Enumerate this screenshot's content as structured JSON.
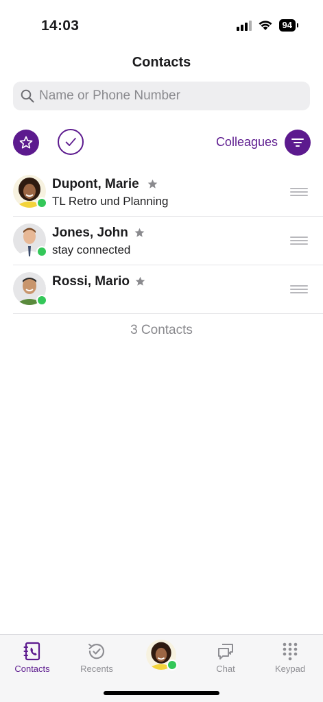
{
  "status_bar": {
    "time": "14:03",
    "battery": "94"
  },
  "header": {
    "title": "Contacts"
  },
  "search": {
    "placeholder": "Name or Phone Number"
  },
  "filters": {
    "group_label": "Colleagues"
  },
  "contacts": [
    {
      "name": "Dupont, Marie",
      "status": "TL Retro und Planning",
      "favorite": true,
      "presence": "available"
    },
    {
      "name": "Jones, John",
      "status": "stay connected",
      "favorite": true,
      "presence": "available"
    },
    {
      "name": "Rossi, Mario",
      "status": "",
      "favorite": true,
      "presence": "available"
    }
  ],
  "contact_count_label": "3 Contacts",
  "tab_bar": {
    "tabs": [
      {
        "label": "Contacts",
        "icon": "contacts-book-icon",
        "active": true
      },
      {
        "label": "Recents",
        "icon": "recents-clock-icon",
        "active": false
      },
      {
        "label": "",
        "icon": "my-avatar",
        "active": false
      },
      {
        "label": "Chat",
        "icon": "chat-bubbles-icon",
        "active": false
      },
      {
        "label": "Keypad",
        "icon": "keypad-icon",
        "active": false
      }
    ]
  },
  "colors": {
    "accent": "#5c1a8e",
    "presence_available": "#34c759",
    "search_bg": "#eeeef0"
  }
}
